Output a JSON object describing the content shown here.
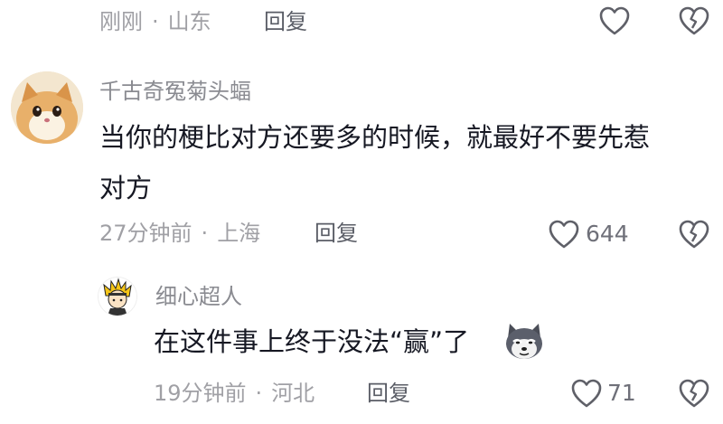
{
  "comments": [
    {
      "meta_time": "刚刚",
      "meta_location": "山东",
      "reply_label": "回复"
    },
    {
      "username": "千古奇冤菊头蝠",
      "text_line1": "当你的梗比对方还要多的时候，就最好不要先惹",
      "text_line2": "对方",
      "meta_time": "27分钟前",
      "meta_location": "上海",
      "reply_label": "回复",
      "like_count": "644"
    },
    {
      "username": "细心超人",
      "text_prefix": "在这件事上终于没法",
      "text_quote": "“赢”",
      "text_suffix": "了",
      "meta_time": "19分钟前",
      "meta_location": "河北",
      "reply_label": "回复",
      "like_count": "71"
    }
  ],
  "separator": "·",
  "colors": {
    "text_primary": "#161823",
    "text_meta": "#a0a0a5",
    "icon_stroke": "#5f6068"
  }
}
